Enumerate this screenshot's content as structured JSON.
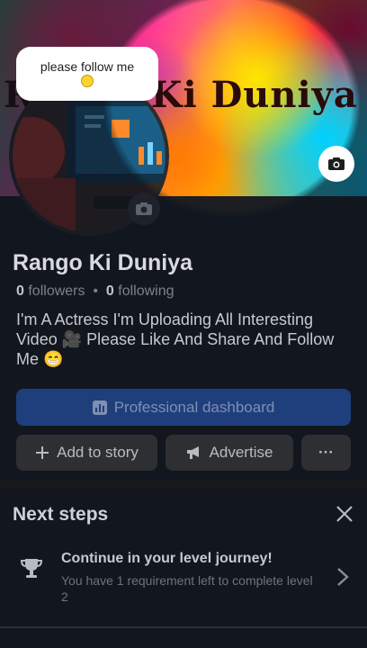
{
  "cover": {
    "title": "Rango Ki Duniya"
  },
  "tooltip": {
    "text": "please follow me"
  },
  "profile": {
    "name": "Rango Ki Duniya",
    "followers_count": "0",
    "followers_label": "followers",
    "separator": "•",
    "following_count": "0",
    "following_label": "following",
    "bio": "I'm A Actress I'm Uploading All Interesting Video 🎥 Please Like And Share And Follow Me 😁"
  },
  "actions": {
    "professional_dashboard": "Professional dashboard",
    "add_to_story": "Add to story",
    "advertise": "Advertise",
    "more": "···"
  },
  "next_steps": {
    "title": "Next steps",
    "item_title": "Continue in your level journey!",
    "item_subtitle": "You have 1 requirement left to complete level 2"
  },
  "icons": [
    "camera-icon",
    "dashboard-icon",
    "plus-icon",
    "megaphone-icon",
    "close-icon",
    "trophy-icon",
    "chevron-right-icon"
  ],
  "colors": {
    "accent": "#1f3f7c",
    "background": "#242526"
  }
}
